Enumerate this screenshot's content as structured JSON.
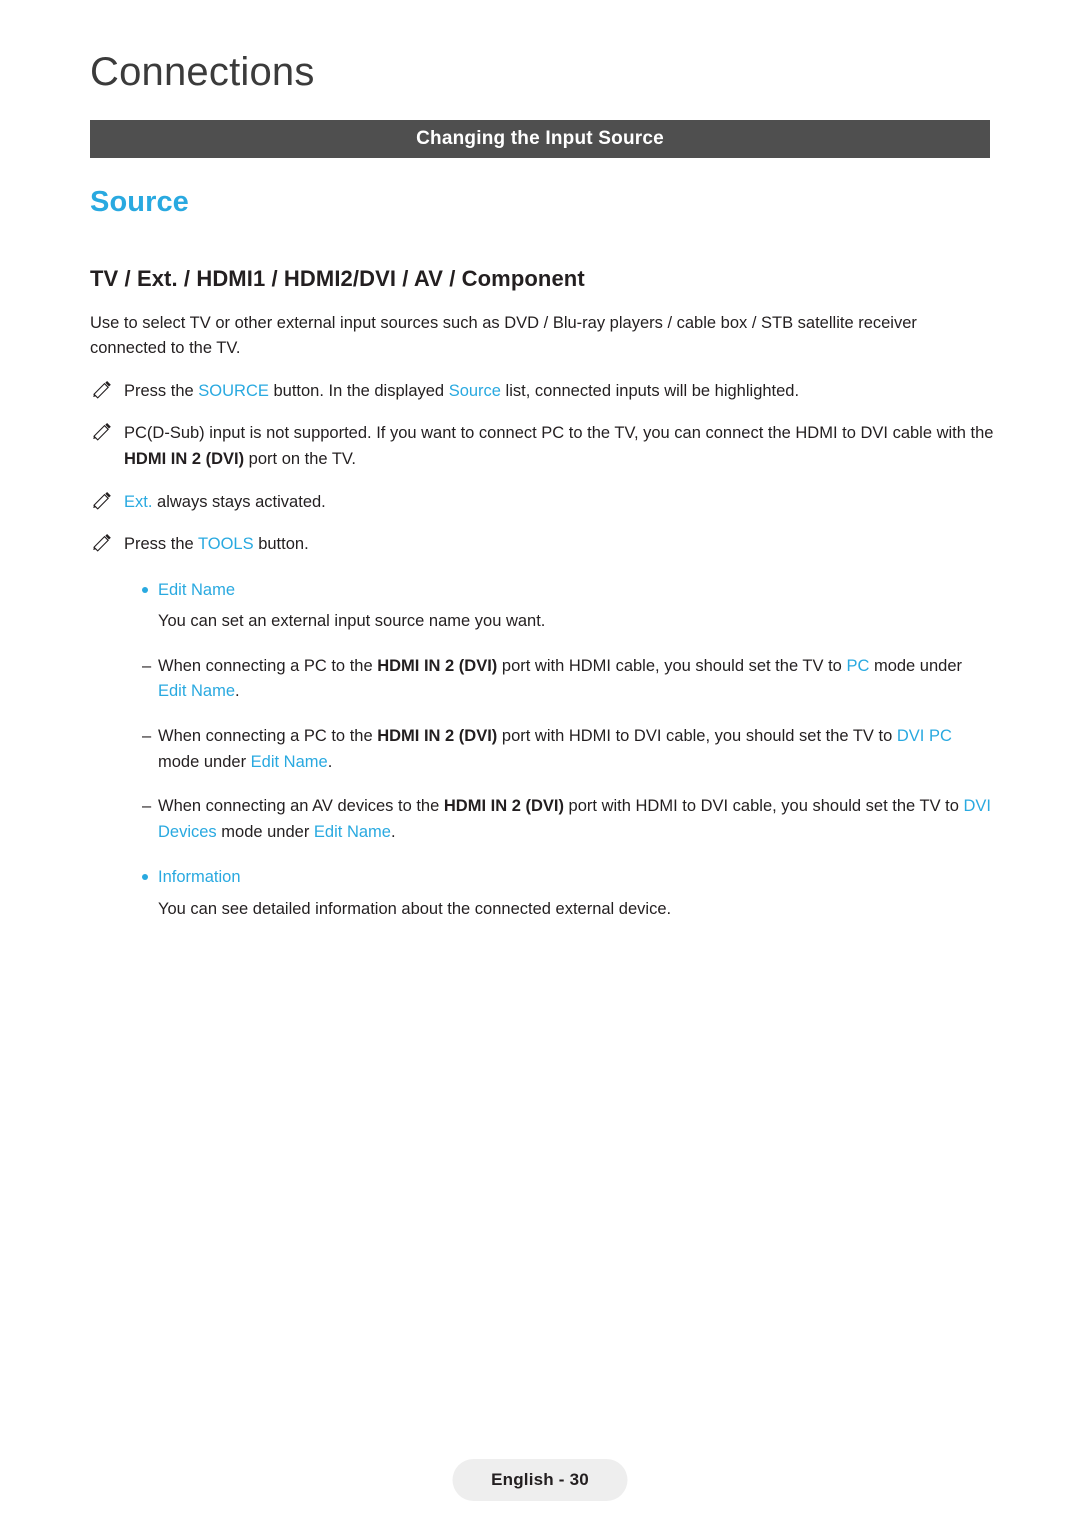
{
  "header": {
    "chapter": "Connections",
    "section_bar": "Changing the Input Source"
  },
  "main": {
    "page_heading": "Source",
    "sub_heading": "TV / Ext. / HDMI1 / HDMI2/DVI / AV / Component",
    "intro": "Use to select TV or other external input sources such as DVD / Blu-ray players / cable box / STB satellite receiver connected to the TV.",
    "notes": [
      {
        "id": "note-source-button",
        "parts": [
          {
            "text": "Press the ",
            "style": "normal"
          },
          {
            "text": "SOURCE",
            "style": "blue"
          },
          {
            "text": " button. In the displayed ",
            "style": "normal"
          },
          {
            "text": "Source",
            "style": "blue"
          },
          {
            "text": " list, connected inputs will be highlighted.",
            "style": "normal"
          }
        ]
      },
      {
        "id": "note-pc-dsub",
        "parts": [
          {
            "text": "PC(D-Sub) input is not supported. If you want to connect PC to the TV, you can connect the HDMI to DVI cable with the ",
            "style": "normal"
          },
          {
            "text": "HDMI IN 2 (DVI)",
            "style": "bold"
          },
          {
            "text": " port on the TV.",
            "style": "normal"
          }
        ]
      },
      {
        "id": "note-ext-activated",
        "parts": [
          {
            "text": "Ext.",
            "style": "blue"
          },
          {
            "text": " always stays activated.",
            "style": "normal"
          }
        ]
      },
      {
        "id": "note-tools-button",
        "parts": [
          {
            "text": "Press the ",
            "style": "normal"
          },
          {
            "text": "TOOLS",
            "style": "blue"
          },
          {
            "text": " button.",
            "style": "normal"
          }
        ]
      }
    ],
    "bullets": [
      {
        "id": "bullet-edit-name",
        "label": "Edit Name",
        "body": "You can set an external input source name you want."
      },
      {
        "id": "bullet-information",
        "label": "Information",
        "body": "You can see detailed information about the connected external device."
      }
    ],
    "dashes": [
      {
        "id": "dash-pc-mode",
        "mark": "–",
        "parts": [
          {
            "text": "When connecting a PC to the ",
            "style": "normal"
          },
          {
            "text": "HDMI IN 2 (DVI)",
            "style": "bold"
          },
          {
            "text": " port with HDMI cable, you should set the TV to ",
            "style": "normal"
          },
          {
            "text": "PC",
            "style": "blue"
          },
          {
            "text": " mode under ",
            "style": "normal"
          },
          {
            "text": "Edit Name",
            "style": "blue"
          },
          {
            "text": ".",
            "style": "normal"
          }
        ]
      },
      {
        "id": "dash-dvi-pc-mode",
        "mark": "–",
        "parts": [
          {
            "text": "When connecting a PC to the ",
            "style": "normal"
          },
          {
            "text": "HDMI IN 2 (DVI)",
            "style": "bold"
          },
          {
            "text": " port with HDMI to DVI cable, you should set the TV to ",
            "style": "normal"
          },
          {
            "text": "DVI PC",
            "style": "blue"
          },
          {
            "text": " mode under ",
            "style": "normal"
          },
          {
            "text": "Edit Name",
            "style": "blue"
          },
          {
            "text": ".",
            "style": "normal"
          }
        ]
      },
      {
        "id": "dash-dvi-devices-mode",
        "mark": "–",
        "parts": [
          {
            "text": "When connecting an AV devices to the ",
            "style": "normal"
          },
          {
            "text": "HDMI IN 2 (DVI)",
            "style": "bold"
          },
          {
            "text": " port with HDMI to DVI cable, you should set the TV to ",
            "style": "normal"
          },
          {
            "text": "DVI Devices",
            "style": "blue"
          },
          {
            "text": " mode under ",
            "style": "normal"
          },
          {
            "text": "Edit Name",
            "style": "blue"
          },
          {
            "text": ".",
            "style": "normal"
          }
        ]
      }
    ]
  },
  "footer": {
    "page_label": "English - 30"
  },
  "colors": {
    "accent": "#29a9e0",
    "bar": "#4f4f4f",
    "text": "#231f20",
    "footer_bg": "#eeeeee"
  }
}
